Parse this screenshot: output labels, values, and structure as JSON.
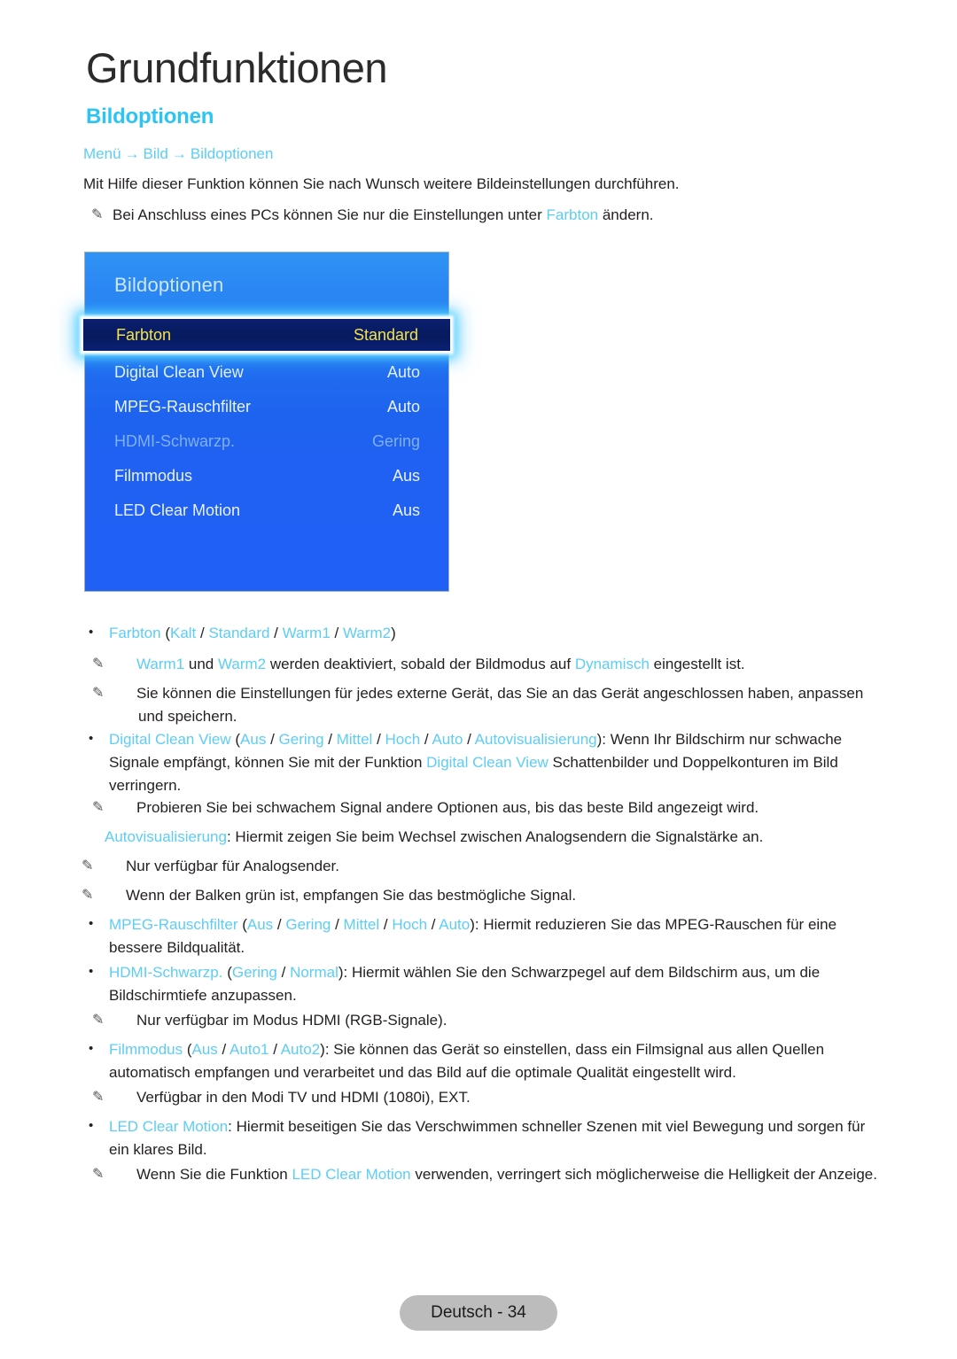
{
  "header": {
    "chapter_title": "Grundfunktionen",
    "section_title": "Bildoptionen",
    "breadcrumb": {
      "item1": "Menü",
      "arrow1": "→",
      "item2": "Bild",
      "arrow2": "→",
      "item3": "Bildoptionen"
    },
    "intro": "Mit Hilfe dieser Funktion können Sie nach Wunsch weitere Bildeinstellungen durchführen.",
    "note1": {
      "icon": "pencil-note-icon",
      "glyph": "✎",
      "part1": "Bei Anschluss eines PCs können Sie nur die Einstellungen unter ",
      "link": "Farbton",
      "part2": " ändern."
    }
  },
  "osd": {
    "title": "Bildoptionen",
    "rows": [
      {
        "label": "Farbton",
        "value": "Standard",
        "state": "selected"
      },
      {
        "label": "Digital Clean View",
        "value": "Auto",
        "state": "normal"
      },
      {
        "label": "MPEG-Rauschfilter",
        "value": "Auto",
        "state": "normal"
      },
      {
        "label": "HDMI-Schwarzp.",
        "value": "Gering",
        "state": "dim"
      },
      {
        "label": "Filmmodus",
        "value": "Aus",
        "state": "normal"
      },
      {
        "label": "LED Clear Motion",
        "value": "Aus",
        "state": "normal"
      }
    ]
  },
  "body": {
    "b1": {
      "term": "Farbton",
      "open": " (",
      "opt1": "Kalt",
      "sep1": " / ",
      "opt2": "Standard",
      "sep2": " / ",
      "opt3": "Warm1",
      "sep3": " / ",
      "opt4": "Warm2",
      "close": ")"
    },
    "n1": {
      "glyph": "✎",
      "p1": "",
      "l1": "Warm1",
      "p2": " und ",
      "l2": "Warm2",
      "p3": " werden deaktiviert, sobald der Bildmodus auf ",
      "l3": "Dynamisch",
      "p4": " eingestellt ist."
    },
    "n2": {
      "glyph": "✎",
      "text": "Sie können die Einstellungen für jedes externe Gerät, das Sie an das Gerät angeschlossen haben, anpassen und speichern."
    },
    "b2": {
      "term": "Digital Clean View",
      "open": " (",
      "opt1": "Aus",
      "sep1": " / ",
      "opt2": "Gering",
      "sep2": " / ",
      "opt3": "Mittel",
      "sep3": " / ",
      "opt4": "Hoch",
      "sep4": " / ",
      "opt5": "Auto",
      "sep5": " / ",
      "opt6": "Autovisualisierung",
      "close": "): Wenn Ihr Bildschirm nur schwache Signale empfängt, können Sie mit der Funktion ",
      "term2": "Digital Clean View",
      "tail": " Schattenbilder und Doppelkonturen im Bild verringern."
    },
    "n3": {
      "glyph": "✎",
      "text": "Probieren Sie bei schwachem Signal andere Optionen aus, bis das beste Bild angezeigt wird."
    },
    "p1": {
      "term": "Autovisualisierung",
      "text": ": Hiermit zeigen Sie beim Wechsel zwischen Analogsendern die Signalstärke an."
    },
    "n4": {
      "glyph": "✎",
      "text": "Nur verfügbar für Analogsender."
    },
    "n5": {
      "glyph": "✎",
      "text": "Wenn der Balken grün ist, empfangen Sie das bestmögliche Signal."
    },
    "b3": {
      "term": "MPEG-Rauschfilter",
      "open": " (",
      "opt1": "Aus",
      "sep1": " / ",
      "opt2": "Gering",
      "sep2": " / ",
      "opt3": "Mittel",
      "sep3": " / ",
      "opt4": "Hoch",
      "sep4": " / ",
      "opt5": "Auto",
      "close": "): Hiermit reduzieren Sie das MPEG-Rauschen für eine bessere Bildqualität."
    },
    "b4": {
      "term": "HDMI-Schwarzp.",
      "open": " (",
      "opt1": "Gering",
      "sep1": " / ",
      "opt2": "Normal",
      "close": "): Hiermit wählen Sie den Schwarzpegel auf dem Bildschirm aus, um die Bildschirmtiefe anzupassen."
    },
    "n6": {
      "glyph": "✎",
      "text": "Nur verfügbar im Modus HDMI (RGB-Signale)."
    },
    "b5": {
      "term": "Filmmodus",
      "open": " (",
      "opt1": "Aus",
      "sep1": " / ",
      "opt2": "Auto1",
      "sep2": " / ",
      "opt3": "Auto2",
      "close": "): Sie können das Gerät so einstellen, dass ein Filmsignal aus allen Quellen automatisch empfangen und verarbeitet und das Bild auf die optimale Qualität eingestellt wird."
    },
    "n7": {
      "glyph": "✎",
      "text": "Verfügbar in den Modi TV und HDMI (1080i), EXT."
    },
    "b6": {
      "term": "LED Clear Motion",
      "close": ": Hiermit beseitigen Sie das Verschwimmen schneller Szenen mit viel Bewegung und sorgen für ein klares Bild."
    },
    "n8": {
      "glyph": "✎",
      "p1": "Wenn Sie die Funktion ",
      "l1": "LED Clear Motion",
      "p2": " verwenden, verringert sich möglicherweise die Helligkeit der Anzeige."
    }
  },
  "footer": {
    "label": "Deutsch - 34"
  },
  "colors": {
    "accent_cyan": "#2bc4f3",
    "link_cyan": "#5ccdf5",
    "osd_blue": "#2060f2",
    "osd_selected_bg": "#071a5e",
    "osd_selected_text": "#f4e24a",
    "footer_pill": "#bcbcbc"
  }
}
